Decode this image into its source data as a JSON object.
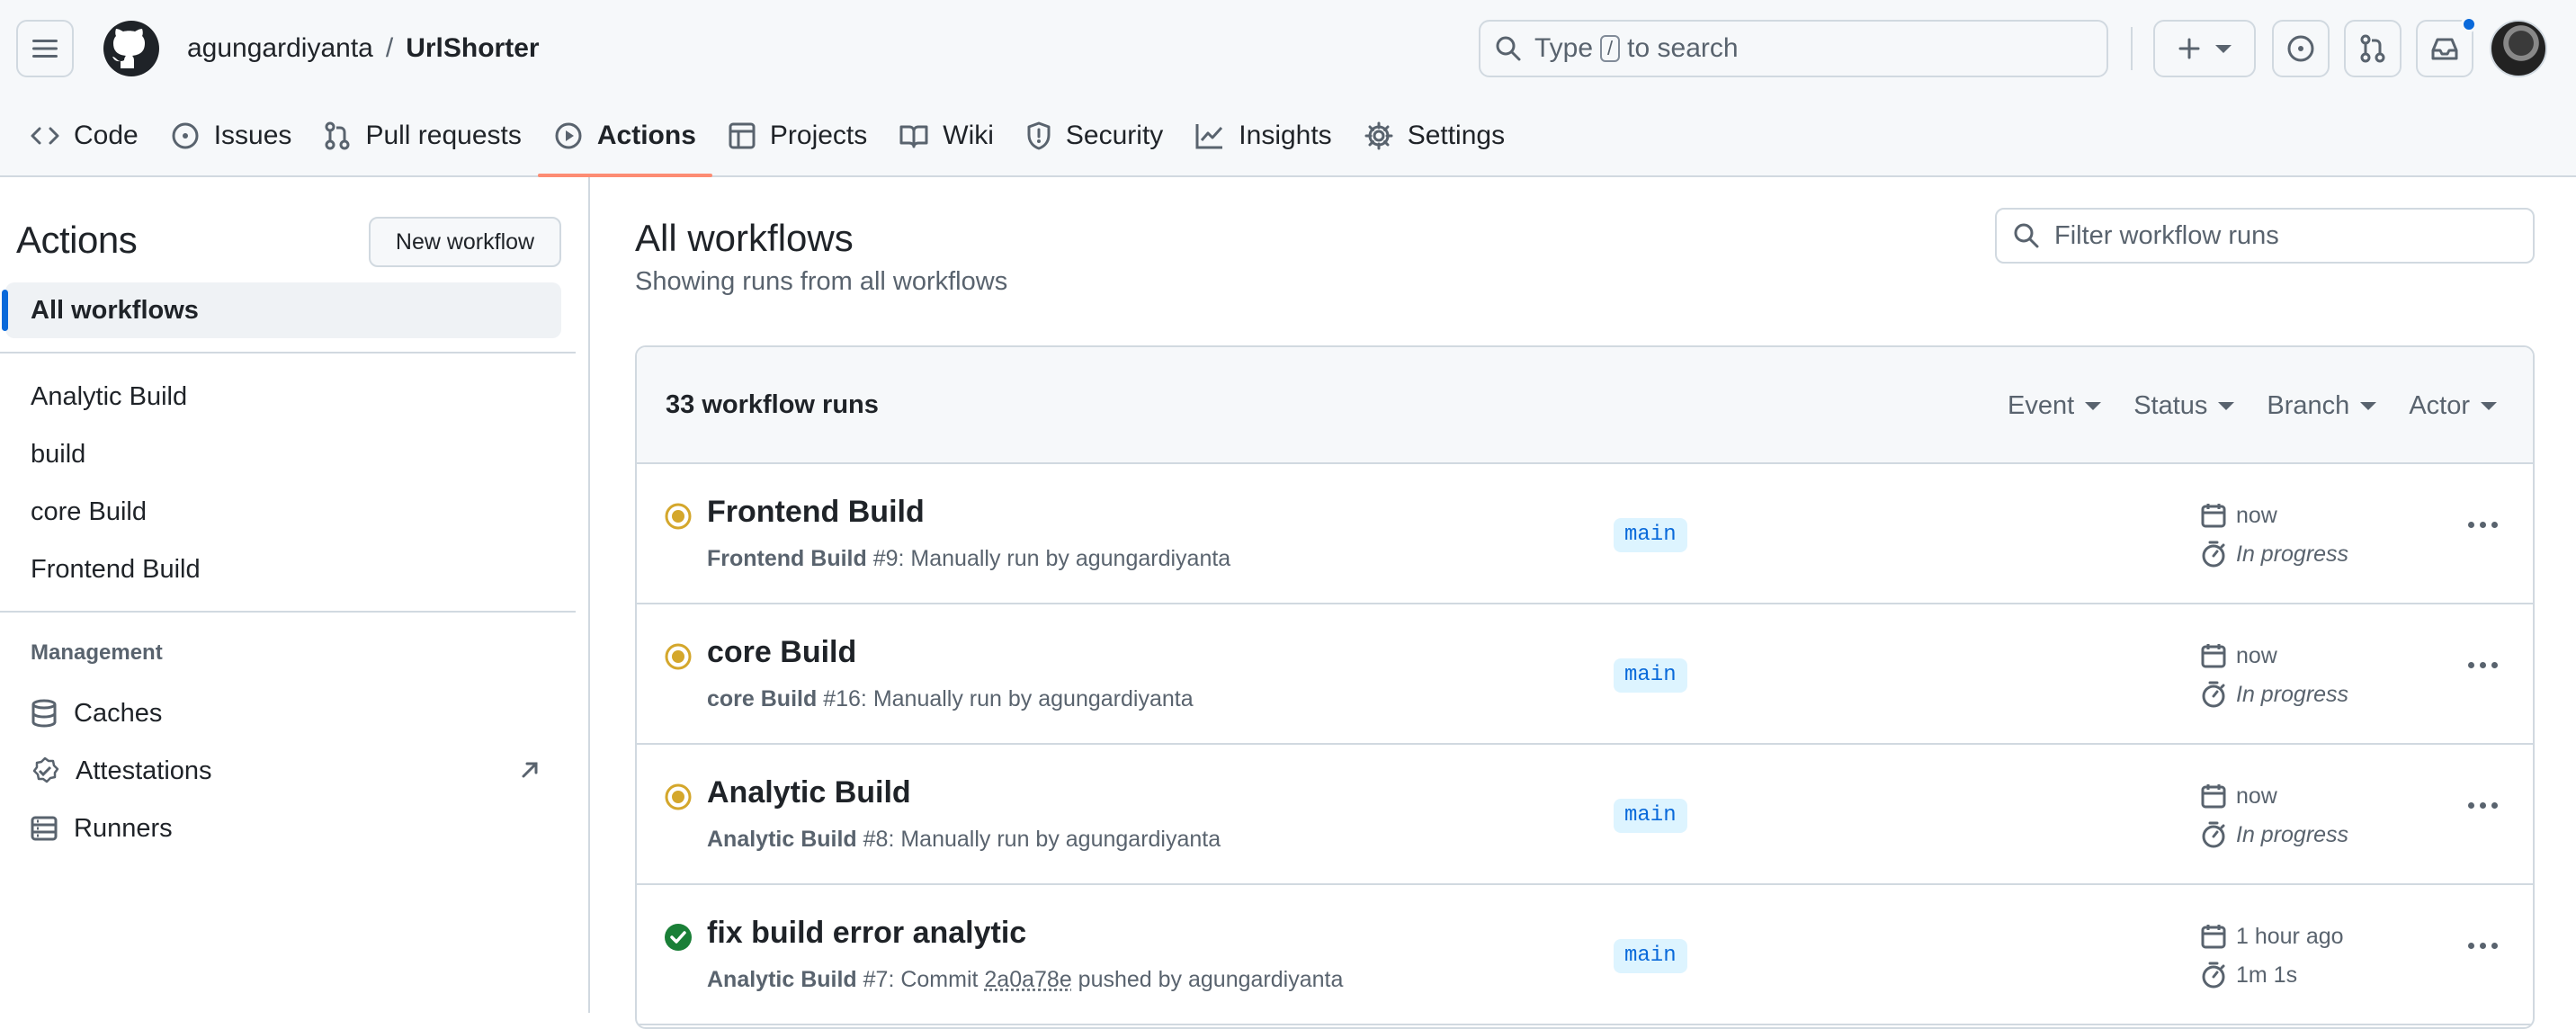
{
  "header": {
    "owner": "agungardiyanta",
    "separator": "/",
    "repo": "UrlShorter",
    "search_prefix": "Type",
    "search_key": "/",
    "search_suffix": "to search"
  },
  "tabs": [
    {
      "label": "Code",
      "icon": "code-icon"
    },
    {
      "label": "Issues",
      "icon": "issue-opened-icon"
    },
    {
      "label": "Pull requests",
      "icon": "git-pull-request-icon"
    },
    {
      "label": "Actions",
      "icon": "play-icon",
      "active": true
    },
    {
      "label": "Projects",
      "icon": "table-icon"
    },
    {
      "label": "Wiki",
      "icon": "book-icon"
    },
    {
      "label": "Security",
      "icon": "shield-icon"
    },
    {
      "label": "Insights",
      "icon": "graph-icon"
    },
    {
      "label": "Settings",
      "icon": "gear-icon"
    }
  ],
  "sidebar": {
    "title": "Actions",
    "new_workflow": "New workflow",
    "all_workflows": "All workflows",
    "workflows": [
      "Analytic Build",
      "build",
      "core Build",
      "Frontend Build"
    ],
    "management_heading": "Management",
    "management": [
      {
        "label": "Caches",
        "icon": "database-icon"
      },
      {
        "label": "Attestations",
        "icon": "verified-icon"
      },
      {
        "label": "Runners",
        "icon": "server-icon"
      }
    ]
  },
  "main": {
    "title": "All workflows",
    "subtitle": "Showing runs from all workflows",
    "filter_placeholder": "Filter workflow runs",
    "runs_count": "33 workflow runs",
    "filters": [
      "Event",
      "Status",
      "Branch",
      "Actor"
    ],
    "runs": [
      {
        "title": "Frontend Build",
        "workflow": "Frontend Build",
        "meta_num": "#9",
        "meta_rest": ": Manually run by agungardiyanta",
        "branch": "main",
        "when": "now",
        "duration": "In progress",
        "status": "in-progress"
      },
      {
        "title": "core Build",
        "workflow": "core Build",
        "meta_num": "#16",
        "meta_rest": ": Manually run by agungardiyanta",
        "branch": "main",
        "when": "now",
        "duration": "In progress",
        "status": "in-progress"
      },
      {
        "title": "Analytic Build",
        "workflow": "Analytic Build",
        "meta_num": "#8",
        "meta_rest": ": Manually run by agungardiyanta",
        "branch": "main",
        "when": "now",
        "duration": "In progress",
        "status": "in-progress"
      },
      {
        "title": "fix build error analytic",
        "workflow": "Analytic Build",
        "meta_num": "#7",
        "meta_rest": ": Commit ",
        "commit": "2a0a78e",
        "meta_tail": " pushed by agungardiyanta",
        "branch": "main",
        "when": "1 hour ago",
        "duration": "1m 1s",
        "status": "success"
      }
    ]
  },
  "colors": {
    "accent": "#fd8c73",
    "link": "#0969da",
    "in_progress": "#d4a72c",
    "success": "#1a7f37"
  }
}
